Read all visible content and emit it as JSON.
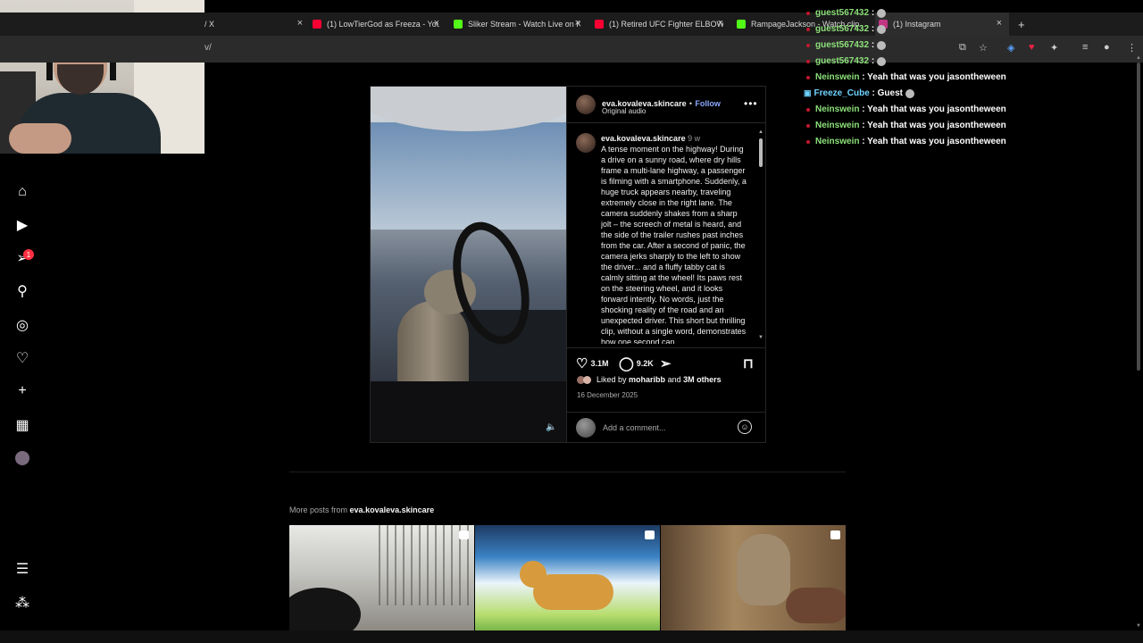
{
  "browser": {
    "tabs": [
      {
        "title": "/ X",
        "close": "×"
      },
      {
        "title": "(1) LowTierGod as Freeza - You",
        "close": "×"
      },
      {
        "title": "Sliker Stream - Watch Live on K",
        "close": "×"
      },
      {
        "title": "(1) Retired UFC Fighter ELBOW",
        "close": "×"
      },
      {
        "title": "RampageJackson - Watch clip",
        "close": "×"
      },
      {
        "title": "(1) Instagram",
        "close": "×"
      }
    ],
    "new_tab": "+",
    "url_fragment": "v/"
  },
  "sidebar": {
    "icons": [
      "home-icon",
      "reels-icon",
      "direct-icon",
      "search-icon",
      "explore-icon",
      "heart-icon",
      "create-icon",
      "dashboard-icon",
      "profile-icon",
      "menu-icon",
      "also-from-meta-icon"
    ],
    "notification_count": "1"
  },
  "post": {
    "author": "eva.kovaleva.skincare",
    "separator": "•",
    "follow_label": "Follow",
    "audio": "Original audio",
    "caption_time": "9 w",
    "caption": "A tense moment on the highway! During a drive on a sunny road, where dry hills frame a multi-lane highway, a passenger is filming with a smartphone. Suddenly, a huge truck appears nearby, traveling extremely close in the right lane. The camera suddenly shakes from a sharp jolt – the screech of metal is heard, and the side of the trailer rushes past inches from the car. After a second of panic, the camera jerks sharply to the left to show the driver... and a fluffy tabby cat is calmly sitting at the wheel! Its paws rest on the steering wheel, and it looks forward intently. No words, just the shocking reality of the road and an unexpected driver. This short but thrilling clip, without a single word, demonstrates how one second can",
    "likes": "3.1M",
    "comments": "9.2K",
    "liked_by_prefix": "Liked by",
    "liked_by_user": "moharibb",
    "liked_by_and": "and",
    "liked_by_others": "3M others",
    "date": "16 December 2025",
    "comment_placeholder": "Add a comment..."
  },
  "more_posts": {
    "prefix": "More posts from",
    "author": "eva.kovaleva.skincare"
  },
  "chat": [
    {
      "user": "guest567432",
      "text": ":"
    },
    {
      "user": "guest567432",
      "text": ":"
    },
    {
      "user": "guest567432",
      "text": ":"
    },
    {
      "user": "guest567432",
      "text": ":"
    },
    {
      "user": "Neinswein",
      "text": ": Yeah that was you jasontheween"
    },
    {
      "user": "Freeze_Cube",
      "text": ": Guest"
    },
    {
      "user": "Neinswein",
      "text": ": Yeah that was you jasontheween"
    },
    {
      "user": "Neinswein",
      "text": ": Yeah that was you jasontheween"
    },
    {
      "user": "Neinswein",
      "text": ": Yeah that was you jasontheween"
    }
  ]
}
